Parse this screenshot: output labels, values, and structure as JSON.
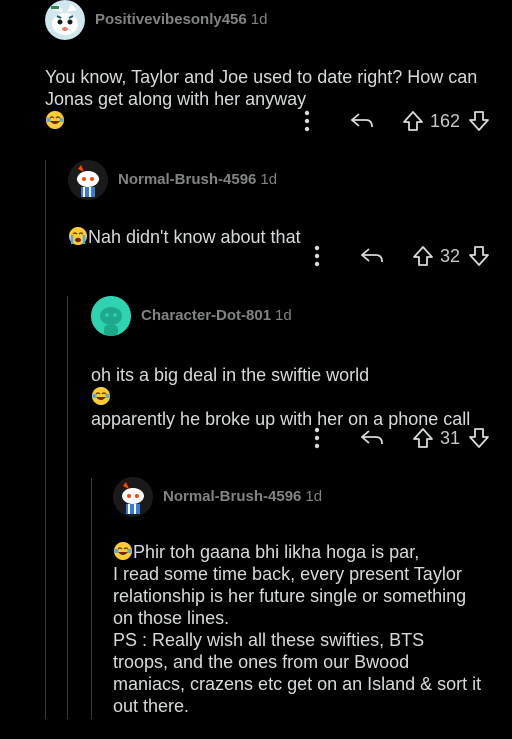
{
  "comments": [
    {
      "user": "Positivevibesonly456",
      "age": "1d",
      "text": "You know, Taylor and Joe used to date right? How can Jonas get along with her anyway",
      "votes": "162"
    },
    {
      "user": "Normal-Brush-4596",
      "age": "1d",
      "text": "Nah didn't know about that",
      "votes": "32"
    },
    {
      "user": "Character-Dot-801",
      "age": "1d",
      "text_line1": "oh its a big deal in the swiftie world",
      "text_line2": "apparently he broke up with her on a phone call",
      "votes": "31"
    },
    {
      "user": "Normal-Brush-4596",
      "age": "1d",
      "line1": "Phir toh gaana bhi likha hoga is par,",
      "rest": "I read some time back, every present Taylor relationship is her future single or something on those lines.\nPS : Really wish all these swifties, BTS troops, and the ones from our Bwood maniacs, crazens etc get on an Island & sort it out there."
    }
  ],
  "icons": {
    "more": "more-vertical-icon",
    "reply": "reply-icon",
    "upvote": "upvote-icon",
    "downvote": "downvote-icon"
  },
  "colors": {
    "background": "#000000",
    "text": "#d7dadc",
    "meta": "#818384",
    "teal_avatar": "#2ed3b0"
  }
}
